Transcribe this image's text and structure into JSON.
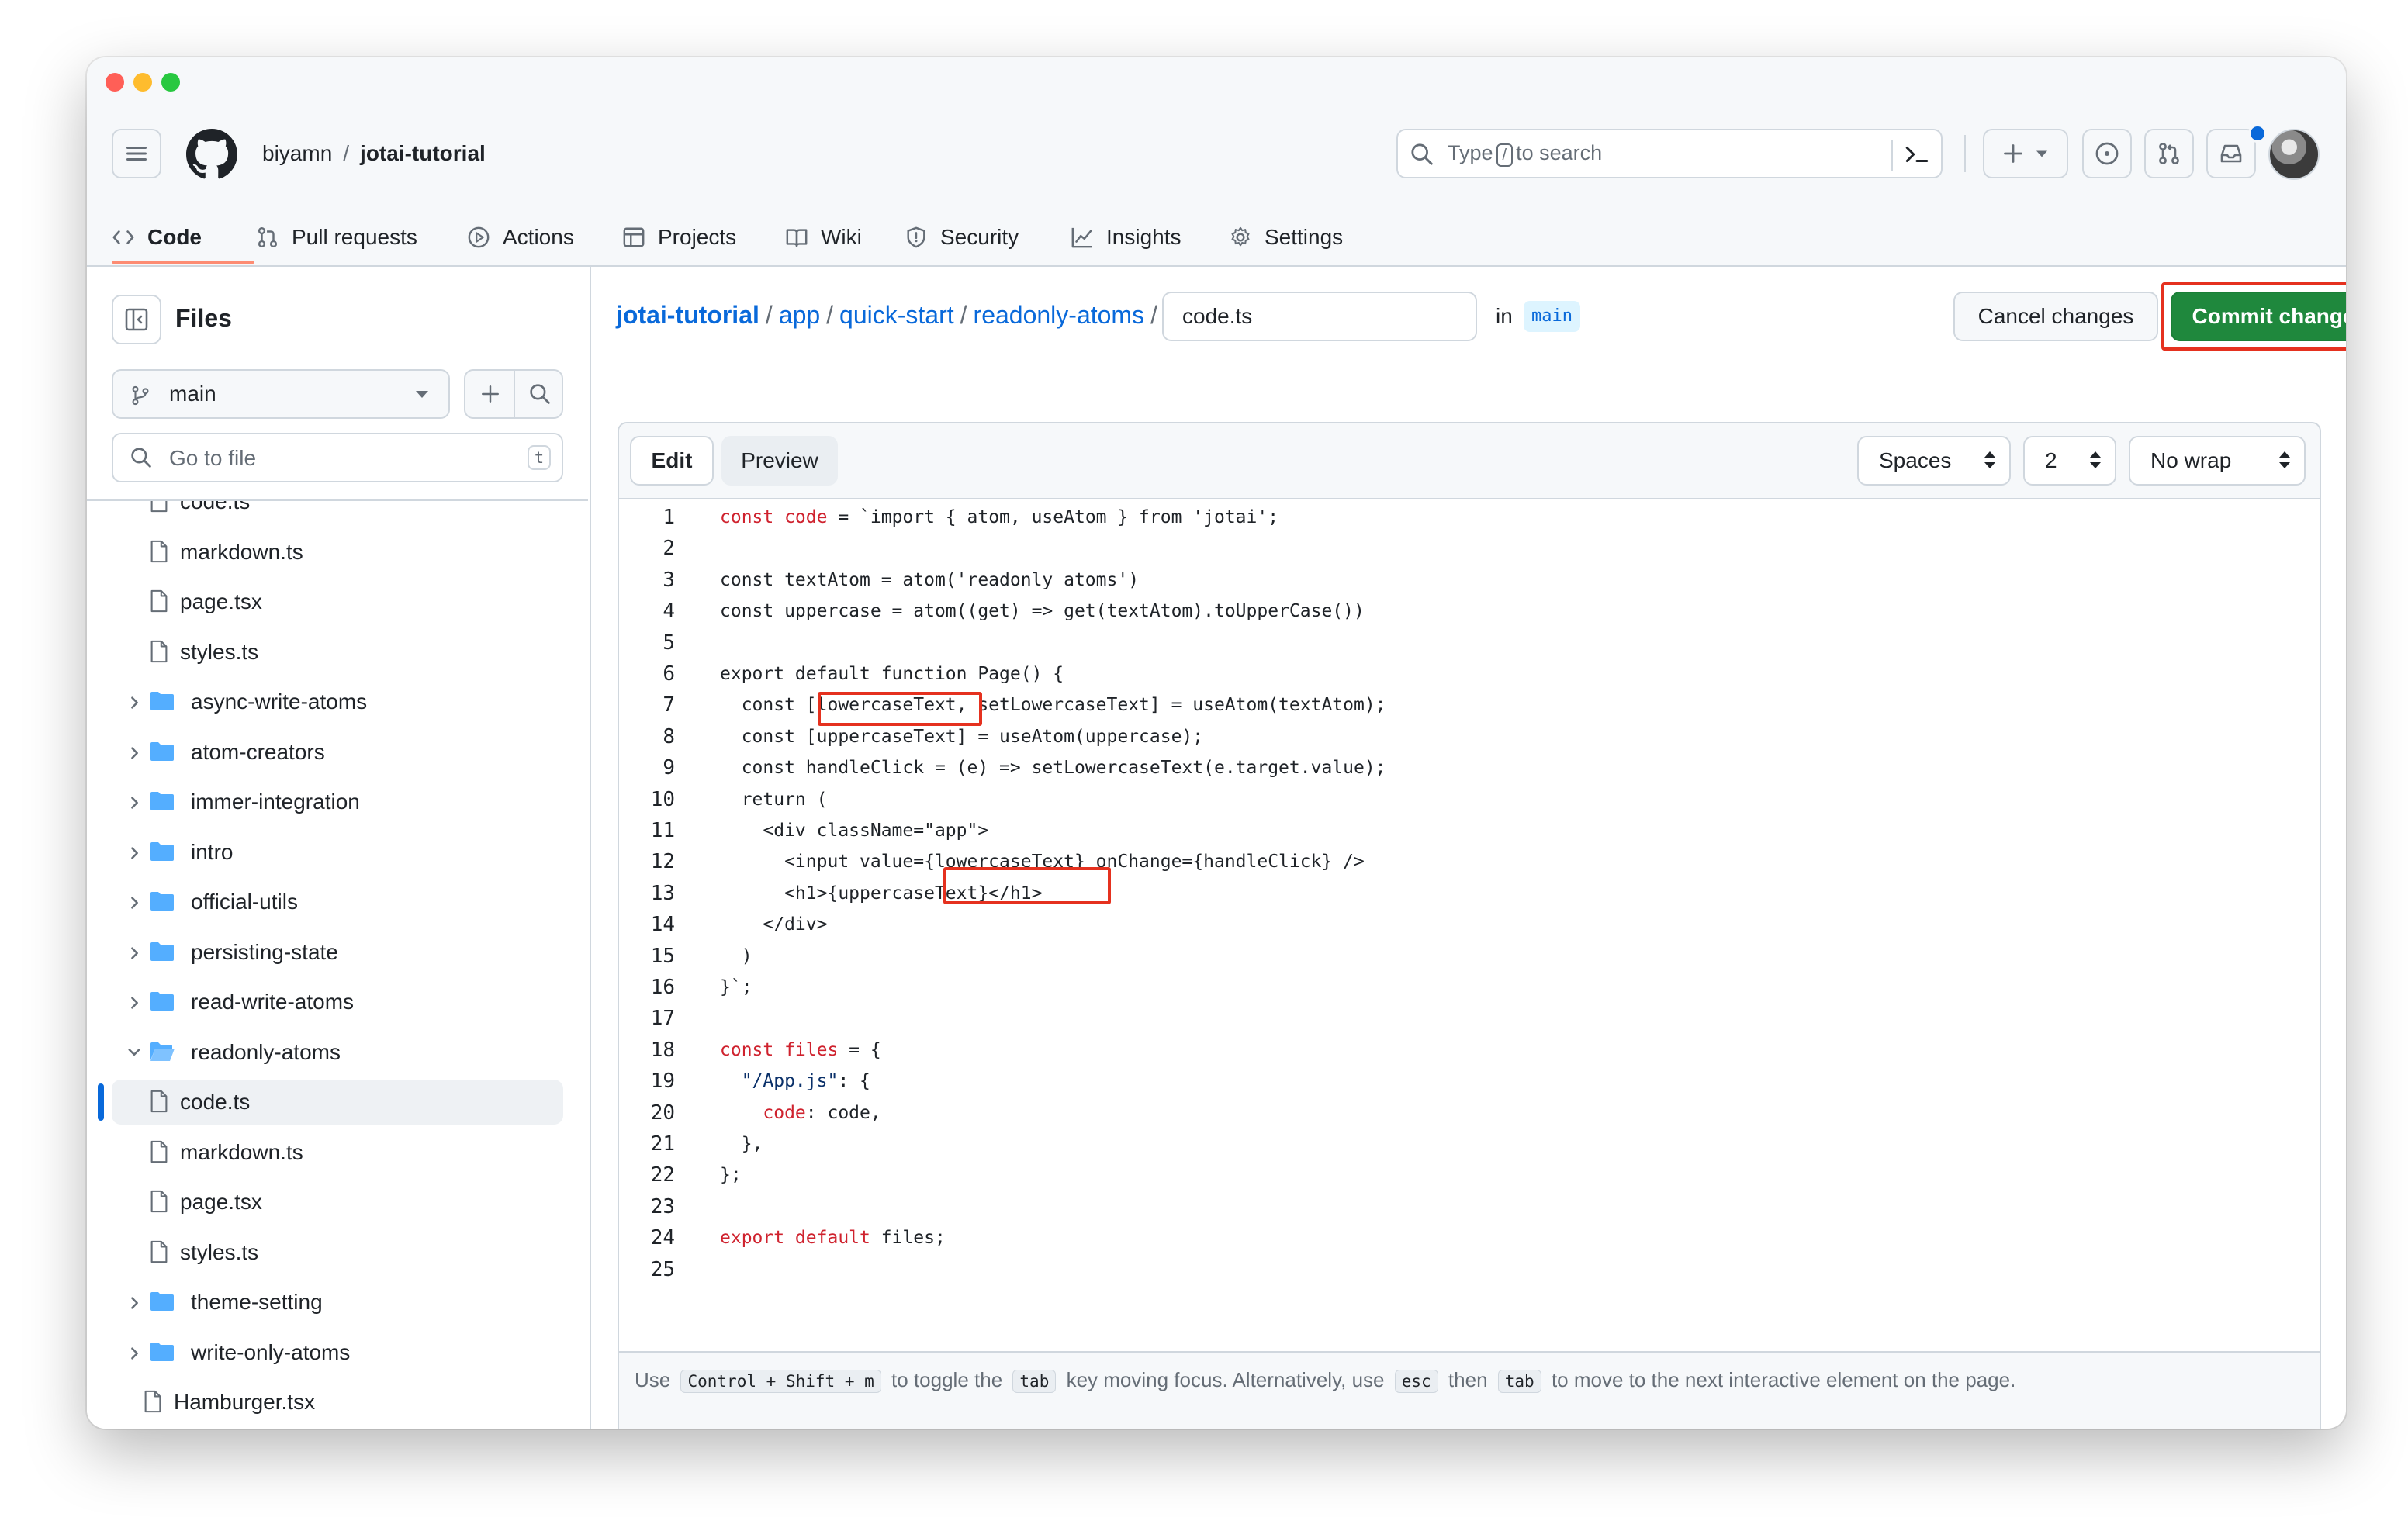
{
  "header": {
    "owner": "biyamn",
    "separator": "/",
    "repo": "jotai-tutorial",
    "search": {
      "prefix": "Type",
      "key": "/",
      "suffix": "to search"
    }
  },
  "nav_tabs": [
    {
      "label": "Code",
      "icon": "code-icon",
      "active": true
    },
    {
      "label": "Pull requests",
      "icon": "pull-request-icon"
    },
    {
      "label": "Actions",
      "icon": "play-icon"
    },
    {
      "label": "Projects",
      "icon": "table-icon"
    },
    {
      "label": "Wiki",
      "icon": "book-icon"
    },
    {
      "label": "Security",
      "icon": "shield-icon"
    },
    {
      "label": "Insights",
      "icon": "graph-icon"
    },
    {
      "label": "Settings",
      "icon": "gear-icon"
    }
  ],
  "sidebar": {
    "title": "Files",
    "branch": "main",
    "goto_placeholder": "Go to file",
    "goto_key": "t",
    "tree": [
      {
        "label": "code.ts",
        "type": "file",
        "depth": 2
      },
      {
        "label": "markdown.ts",
        "type": "file",
        "depth": 2
      },
      {
        "label": "page.tsx",
        "type": "file",
        "depth": 2
      },
      {
        "label": "styles.ts",
        "type": "file",
        "depth": 2
      },
      {
        "label": "async-write-atoms",
        "type": "folder",
        "depth": 1
      },
      {
        "label": "atom-creators",
        "type": "folder",
        "depth": 1
      },
      {
        "label": "immer-integration",
        "type": "folder",
        "depth": 1
      },
      {
        "label": "intro",
        "type": "folder",
        "depth": 1
      },
      {
        "label": "official-utils",
        "type": "folder",
        "depth": 1
      },
      {
        "label": "persisting-state",
        "type": "folder",
        "depth": 1
      },
      {
        "label": "read-write-atoms",
        "type": "folder",
        "depth": 1
      },
      {
        "label": "readonly-atoms",
        "type": "folder-open",
        "depth": 1
      },
      {
        "label": "code.ts",
        "type": "file",
        "depth": 2,
        "selected": true
      },
      {
        "label": "markdown.ts",
        "type": "file",
        "depth": 2
      },
      {
        "label": "page.tsx",
        "type": "file",
        "depth": 2
      },
      {
        "label": "styles.ts",
        "type": "file",
        "depth": 2
      },
      {
        "label": "theme-setting",
        "type": "folder",
        "depth": 1
      },
      {
        "label": "write-only-atoms",
        "type": "folder",
        "depth": 1
      },
      {
        "label": "Hamburger.tsx",
        "type": "file",
        "depth": 0
      }
    ]
  },
  "breadcrumb": {
    "parts": [
      "jotai-tutorial",
      "app",
      "quick-start",
      "readonly-atoms"
    ],
    "separator": "/",
    "filename": "code.ts",
    "in_label": "in",
    "branch": "main"
  },
  "actions": {
    "cancel": "Cancel changes",
    "commit": "Commit changes..."
  },
  "editor": {
    "tab_edit": "Edit",
    "tab_preview": "Preview",
    "indent_mode": "Spaces",
    "indent_size": "2",
    "wrap_mode": "No wrap",
    "lines": [
      [
        {
          "t": "const code",
          "c": "kw"
        },
        {
          "t": " = `import { atom, useAtom } from 'jotai';"
        }
      ],
      [],
      [
        {
          "t": "const textAtom = atom('readonly atoms')"
        }
      ],
      [
        {
          "t": "const uppercase = atom((get) => get(textAtom).toUpperCase())"
        }
      ],
      [],
      [
        {
          "t": "export default function Page() {"
        }
      ],
      [
        {
          "t": "  const [lowercaseText, setLowercaseText] = useAtom(textAtom);"
        }
      ],
      [
        {
          "t": "  const [uppercaseText] = useAtom(uppercase);"
        }
      ],
      [
        {
          "t": "  const handleClick = (e) => setLowercaseText(e.target.value);"
        }
      ],
      [
        {
          "t": "  return ("
        }
      ],
      [
        {
          "t": "    <div className=\"app\">"
        }
      ],
      [
        {
          "t": "      <input value={lowercaseText} onChange={handleClick} />"
        }
      ],
      [
        {
          "t": "      <h1>{uppercaseText}</h1>"
        }
      ],
      [
        {
          "t": "    </div>"
        }
      ],
      [
        {
          "t": "  )"
        }
      ],
      [
        {
          "t": "}`;"
        }
      ],
      [],
      [
        {
          "t": "const files",
          "c": "kw"
        },
        {
          "t": " = {"
        }
      ],
      [
        {
          "t": "  \"/App.js\"",
          "c": "st"
        },
        {
          "t": ": {"
        }
      ],
      [
        {
          "t": "    "
        },
        {
          "t": "code",
          "c": "kw"
        },
        {
          "t": ": code,"
        }
      ],
      [
        {
          "t": "  },"
        }
      ],
      [
        {
          "t": "};"
        }
      ],
      [],
      [
        {
          "t": "export default",
          "c": "kw"
        },
        {
          "t": " files;"
        }
      ],
      []
    ],
    "footer": {
      "use": "Use",
      "keys1": [
        "Control",
        "+",
        "Shift",
        "+",
        "m"
      ],
      "toggle": "to toggle the",
      "tab_key": "tab",
      "moving": "key moving focus. Alternatively, use",
      "esc_key": "esc",
      "then": "then",
      "tab_key2": "tab",
      "rest": "to move to the next interactive element on the page."
    }
  },
  "colors": {
    "accent": "#0969da",
    "commit_green": "#1f883d",
    "highlight_red": "#e5311f",
    "tab_underline": "#fd8c73"
  }
}
